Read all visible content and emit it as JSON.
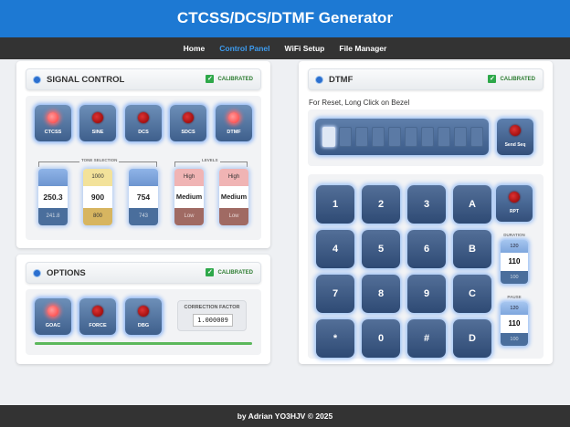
{
  "header": {
    "title": "CTCSS/DCS/DTMF Generator"
  },
  "nav": {
    "items": [
      "Home",
      "Control Panel",
      "WiFi Setup",
      "File Manager"
    ],
    "active": "Control Panel"
  },
  "signal_control": {
    "title": "SIGNAL CONTROL",
    "calibrated": "CALIBRATED",
    "buttons": [
      {
        "label": "CTCSS",
        "led": "on"
      },
      {
        "label": "SINE",
        "led": "off"
      },
      {
        "label": "DCS",
        "led": "off"
      },
      {
        "label": "SDCS",
        "led": "off"
      },
      {
        "label": "DTMF",
        "led": "on"
      }
    ],
    "tone_selection_label": "TONE SELECTION",
    "levels_label": "LEVELS",
    "selectors": [
      {
        "top": "",
        "value": "250.3",
        "bottom": "241.8"
      },
      {
        "top": "1000",
        "value": "900",
        "bottom": "800"
      },
      {
        "top": "",
        "value": "754",
        "bottom": "743"
      },
      {
        "top": "High",
        "value": "Medium",
        "bottom": "Low"
      },
      {
        "top": "High",
        "value": "Medium",
        "bottom": "Low"
      }
    ]
  },
  "options": {
    "title": "OPTIONS",
    "calibrated": "CALIBRATED",
    "buttons": [
      {
        "label": "GOAC",
        "led": "on"
      },
      {
        "label": "FORCE",
        "led": "off"
      },
      {
        "label": "DBG",
        "led": "off"
      }
    ],
    "correction_label": "CORRECTION FACTOR",
    "correction_value": "1.000009",
    "progress": 1.0
  },
  "dtmf": {
    "title": "DTMF",
    "calibrated": "CALIBRATED",
    "hint": "For Reset, Long Click on Bezel",
    "send_label": "Send Seq",
    "keys": [
      "1",
      "2",
      "3",
      "A",
      "4",
      "5",
      "6",
      "B",
      "7",
      "8",
      "9",
      "C",
      "*",
      "0",
      "#",
      "D"
    ],
    "rpt_label": "RPT",
    "duration": {
      "label": "DURATION",
      "top": "120",
      "value": "110",
      "bottom": "100"
    },
    "pause": {
      "label": "PAUSE",
      "top": "120",
      "value": "110",
      "bottom": "100"
    }
  },
  "footer": {
    "text": "by Adrian YO3HJV © 2025"
  },
  "colors": {
    "header": "#1d79d3",
    "nav": "#333333",
    "accent_active": "#3d9cf0",
    "calibrated": "#2e7d32"
  }
}
